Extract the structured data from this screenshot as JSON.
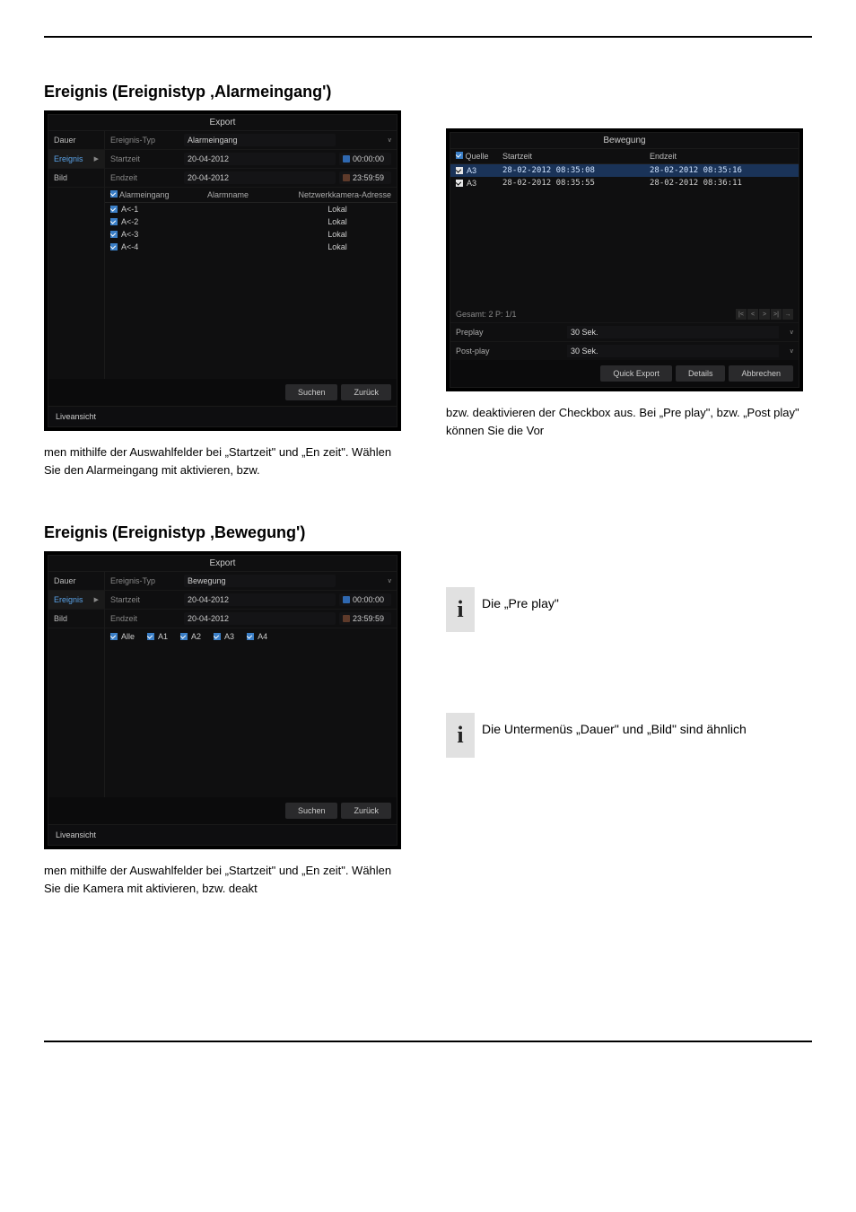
{
  "section1": {
    "title": "Ereignis (Ereignistyp ‚Alarmeingang')",
    "panel": {
      "title": "Export",
      "sidebar": [
        "Dauer",
        "Ereignis",
        "Bild"
      ],
      "selected": "Ereignis",
      "form": {
        "type_label": "Ereignis-Typ",
        "type_value": "Alarmeingang",
        "start_label": "Startzeit",
        "start_date": "20-04-2012",
        "start_time": "00:00:00",
        "end_label": "Endzeit",
        "end_date": "20-04-2012",
        "end_time": "23:59:59"
      },
      "grid": {
        "head": [
          "Alarmeingang",
          "Alarmname",
          "Netzwerkkamera-Adresse"
        ],
        "rows": [
          {
            "name": "A<-1",
            "addr": "Lokal"
          },
          {
            "name": "A<-2",
            "addr": "Lokal"
          },
          {
            "name": "A<-3",
            "addr": "Lokal"
          },
          {
            "name": "A<-4",
            "addr": "Lokal"
          }
        ]
      },
      "buttons": {
        "search": "Suchen",
        "back": "Zurück"
      },
      "footer": "Liveansicht"
    },
    "para_left": "men mithilfe der Auswahlfelder bei „Startzeit\" und „En zeit\". Wählen Sie den Alarmeingang mit aktivieren, bzw.",
    "result_panel": {
      "title": "Bewegung",
      "head": [
        "Quelle",
        "Startzeit",
        "Endzeit"
      ],
      "rows": [
        {
          "src": "A3",
          "start": "28-02-2012 08:35:08",
          "end": "28-02-2012 08:35:16",
          "sel": true
        },
        {
          "src": "A3",
          "start": "28-02-2012 08:35:55",
          "end": "28-02-2012 08:36:11",
          "sel": false
        }
      ],
      "total": "Gesamt: 2 P: 1/1",
      "preplay_label": "Preplay",
      "preplay_value": "30 Sek.",
      "postplay_label": "Post-play",
      "postplay_value": "30 Sek.",
      "buttons": {
        "quick": "Quick Export",
        "details": "Details",
        "cancel": "Abbrechen"
      }
    },
    "para_right": "bzw. deaktivieren der Checkbox aus. Bei „Pre play\", bzw. „Post play\" können Sie die Vor"
  },
  "section2": {
    "title": "Ereignis (Ereignistyp ‚Bewegung')",
    "panel": {
      "title": "Export",
      "sidebar": [
        "Dauer",
        "Ereignis",
        "Bild"
      ],
      "selected": "Ereignis",
      "form": {
        "type_label": "Ereignis-Typ",
        "type_value": "Bewegung",
        "start_label": "Startzeit",
        "start_date": "20-04-2012",
        "start_time": "00:00:00",
        "end_label": "Endzeit",
        "end_date": "20-04-2012",
        "end_time": "23:59:59"
      },
      "cams": {
        "all": "Alle",
        "list": [
          "A1",
          "A2",
          "A3",
          "A4"
        ]
      },
      "buttons": {
        "search": "Suchen",
        "back": "Zurück"
      },
      "footer": "Liveansicht"
    },
    "para_left": "men mithilfe der Auswahlfelder bei „Startzeit\" und „En zeit\". Wählen Sie die Kamera mit aktivieren, bzw. deakt",
    "info1": "Die „Pre play\"",
    "info2": "Die Untermenüs „Dauer\" und „Bild\" sind ähnlich"
  }
}
